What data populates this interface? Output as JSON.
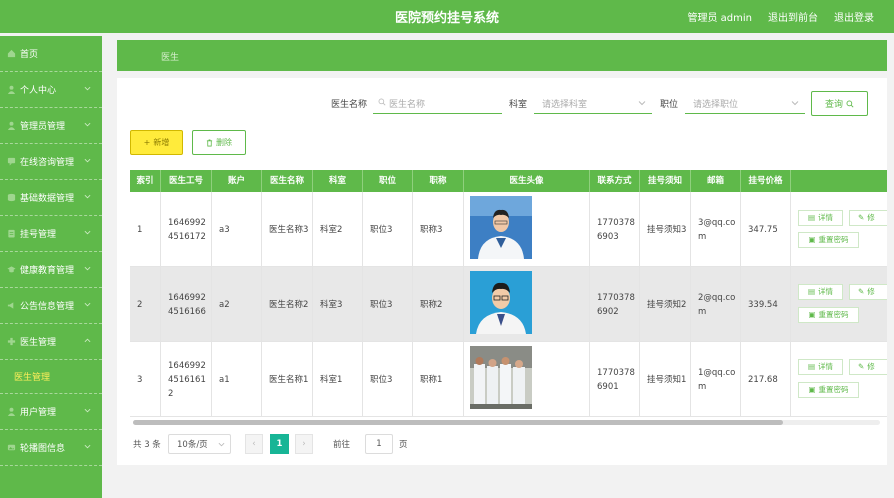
{
  "header": {
    "title": "医院预约挂号系统",
    "user": "管理员 admin",
    "to_front": "退出到前台",
    "logout": "退出登录"
  },
  "sidebar": {
    "items": [
      {
        "label": "首页",
        "icon": "home-icon",
        "chevron": false
      },
      {
        "label": "个人中心",
        "icon": "user-icon",
        "chevron": true
      },
      {
        "label": "管理员管理",
        "icon": "admin-icon",
        "chevron": true
      },
      {
        "label": "在线咨询管理",
        "icon": "chat-icon",
        "chevron": true
      },
      {
        "label": "基础数据管理",
        "icon": "database-icon",
        "chevron": true
      },
      {
        "label": "挂号管理",
        "icon": "register-icon",
        "chevron": true
      },
      {
        "label": "健康教育管理",
        "icon": "education-icon",
        "chevron": true
      },
      {
        "label": "公告信息管理",
        "icon": "notice-icon",
        "chevron": true
      },
      {
        "label": "医生管理",
        "icon": "doctor-icon",
        "chevron": true,
        "expanded": true
      },
      {
        "label": "用户管理",
        "icon": "users-icon",
        "chevron": true
      },
      {
        "label": "轮播图信息",
        "icon": "carousel-icon",
        "chevron": true
      }
    ],
    "submenu_label": "医生管理"
  },
  "breadcrumb": "医生",
  "search": {
    "name_label": "医生名称",
    "name_placeholder": "医生名称",
    "dept_label": "科室",
    "dept_placeholder": "请选择科室",
    "title_label": "职位",
    "title_placeholder": "请选择职位",
    "query_label": "查询"
  },
  "actions": {
    "add_label": "新增",
    "delete_label": "删除"
  },
  "table": {
    "columns": [
      "索引",
      "医生工号",
      "账户",
      "医生名称",
      "科室",
      "职位",
      "职称",
      "医生头像",
      "联系方式",
      "挂号须知",
      "邮箱",
      "挂号价格"
    ],
    "rows": [
      {
        "index": "1",
        "code": "16469924516172",
        "account": "a3",
        "name": "医生名称3",
        "dept": "科室2",
        "position": "职位3",
        "title": "职称3",
        "phone": "17703786903",
        "notice": "挂号须知3",
        "email": "3@qq.com",
        "price": "347.75"
      },
      {
        "index": "2",
        "code": "16469924516166",
        "account": "a2",
        "name": "医生名称2",
        "dept": "科室3",
        "position": "职位3",
        "title": "职称2",
        "phone": "17703786902",
        "notice": "挂号须知2",
        "email": "2@qq.com",
        "price": "339.54"
      },
      {
        "index": "3",
        "code": "164699245161612",
        "account": "a1",
        "name": "医生名称1",
        "dept": "科室1",
        "position": "职位3",
        "title": "职称1",
        "phone": "17703786901",
        "notice": "挂号须知1",
        "email": "1@qq.com",
        "price": "217.68"
      }
    ],
    "op_detail": "详情",
    "op_edit": "修",
    "op_reset": "重置密码"
  },
  "pagination": {
    "total": "共 3 条",
    "page_size": "10条/页",
    "current": "1",
    "goto_label": "前往",
    "goto_value": "1",
    "page_unit": "页"
  },
  "colors": {
    "primary": "#5fb94a",
    "accent_yellow": "#ffeb3b",
    "page_active": "#17b596"
  }
}
